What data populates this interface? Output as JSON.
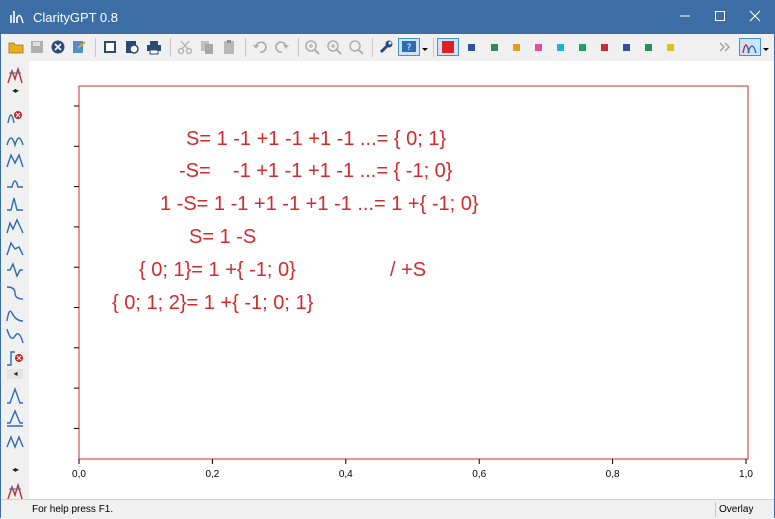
{
  "window": {
    "title": "ClarityGPT 0.8",
    "minimize": "—",
    "maximize": "☐",
    "close": "✕"
  },
  "toolbar": {
    "icons": [
      "open-icon",
      "save-icon",
      "close-doc-icon",
      "export-icon",
      "print-preview-icon",
      "print-setup-icon",
      "print-icon",
      "cut-icon",
      "copy-icon",
      "paste-icon",
      "undo-icon",
      "redo-icon",
      "zoom-in-icon",
      "zoom-fit-icon",
      "zoom-out-icon",
      "settings-icon",
      "help-icon"
    ],
    "colors": [
      "#e02020",
      "#3050a0",
      "#2e8b57",
      "#e0a020",
      "#e050a0",
      "#20b0d0",
      "#20a060",
      "#c03030",
      "#3050a0",
      "#2e8b57",
      "#e0c020"
    ],
    "selected_color": "#e02020"
  },
  "chart": {
    "frame_color": "#d42a2a",
    "x_ticks": [
      "0,0",
      "0,2",
      "0,4",
      "0,6",
      "0,8",
      "1,0"
    ],
    "lines": [
      "S= 1 -1 +1 -1 +1 -1 ...= { 0; 1}",
      "-S=    -1 +1 -1 +1 -1 ...= { -1; 0}",
      "1 -S= 1 -1 +1 -1 +1 -1 ...= 1 +{ -1; 0}",
      "S= 1 -S",
      "{ 0; 1}= 1 +{ -1; 0}",
      "/ +S",
      "{ 0; 1; 2}= 1 +{ -1; 0; 1}"
    ],
    "text_color": "#d42a2a"
  },
  "status": {
    "help": "For help press F1.",
    "mode": "Overlay"
  }
}
